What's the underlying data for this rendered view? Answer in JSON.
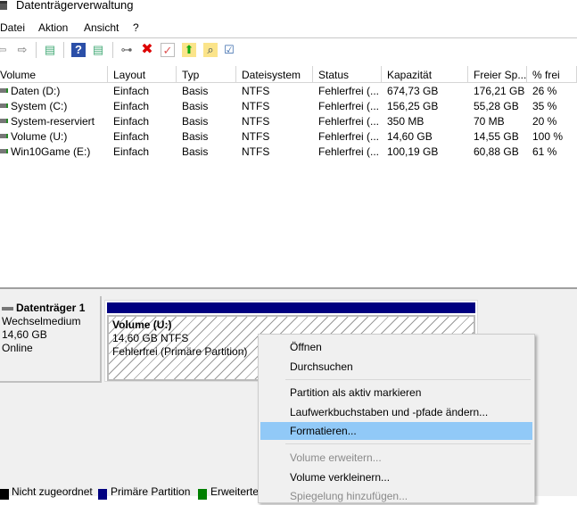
{
  "window": {
    "title": "Datenträgerverwaltung"
  },
  "menu": [
    "Datei",
    "Aktion",
    "Ansicht",
    "?"
  ],
  "toolbar": [
    {
      "icon": "back-icon",
      "glyph": "⇦"
    },
    {
      "icon": "forward-icon",
      "glyph": "⇨"
    },
    {
      "icon": "console-tree-icon",
      "glyph": "▤"
    },
    {
      "icon": "help-icon",
      "glyph": "?"
    },
    {
      "icon": "action-pane-icon",
      "glyph": "▤"
    },
    {
      "icon": "connect-drive-icon",
      "glyph": "⊶"
    },
    {
      "icon": "delete-icon",
      "glyph": "✖"
    },
    {
      "icon": "properties-icon",
      "glyph": "✓"
    },
    {
      "icon": "open-folder-icon",
      "glyph": "⬆"
    },
    {
      "icon": "search-icon",
      "glyph": "⌕"
    },
    {
      "icon": "checklist-icon",
      "glyph": "☑"
    }
  ],
  "columns": [
    "Volume",
    "Layout",
    "Typ",
    "Dateisystem",
    "Status",
    "Kapazität",
    "Freier Sp...",
    "% frei"
  ],
  "rows": [
    [
      "Daten (D:)",
      "Einfach",
      "Basis",
      "NTFS",
      "Fehlerfrei (...",
      "674,73 GB",
      "176,21 GB",
      "26 %"
    ],
    [
      "System (C:)",
      "Einfach",
      "Basis",
      "NTFS",
      "Fehlerfrei (...",
      "156,25 GB",
      "55,28 GB",
      "35 %"
    ],
    [
      "System-reserviert",
      "Einfach",
      "Basis",
      "NTFS",
      "Fehlerfrei (...",
      "350 MB",
      "70 MB",
      "20 %"
    ],
    [
      "Volume (U:)",
      "Einfach",
      "Basis",
      "NTFS",
      "Fehlerfrei (...",
      "14,60 GB",
      "14,55 GB",
      "100 %"
    ],
    [
      "Win10Game (E:)",
      "Einfach",
      "Basis",
      "NTFS",
      "Fehlerfrei (...",
      "100,19 GB",
      "60,88 GB",
      "61 %"
    ]
  ],
  "disk": {
    "name": "Datenträger 1",
    "type": "Wechselmedium",
    "size": "14,60 GB",
    "status": "Online"
  },
  "partition": {
    "name": "Volume  (U:)",
    "size": "14,60 GB NTFS",
    "status": "Fehlerfrei (Primäre Partition)"
  },
  "legend": [
    {
      "label": "Nicht zugeordnet",
      "color": "#000000"
    },
    {
      "label": "Primäre Partition",
      "color": "#000080"
    },
    {
      "label": "Erweiterte",
      "color": "#008000"
    }
  ],
  "context_menu": [
    {
      "label": "Öffnen",
      "state": "normal"
    },
    {
      "label": "Durchsuchen",
      "state": "normal"
    },
    {
      "label": "Partition als aktiv markieren",
      "state": "normal"
    },
    {
      "label": "Laufwerkbuchstaben und -pfade ändern...",
      "state": "normal"
    },
    {
      "label": "Formatieren...",
      "state": "highlighted"
    },
    {
      "label": "Volume erweitern...",
      "state": "disabled"
    },
    {
      "label": "Volume verkleinern...",
      "state": "normal"
    },
    {
      "label": "Spiegelung hinzufügen...",
      "state": "disabled"
    }
  ]
}
